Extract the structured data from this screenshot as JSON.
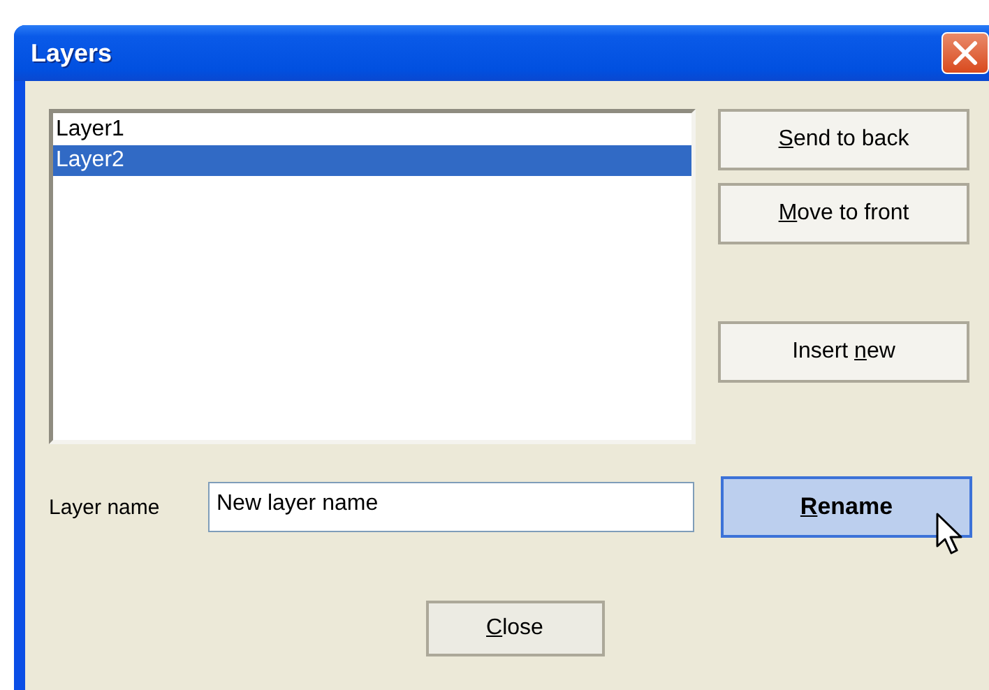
{
  "window": {
    "title": "Layers"
  },
  "layers": {
    "items": [
      {
        "label": "Layer1",
        "selected": false
      },
      {
        "label": "Layer2",
        "selected": true
      }
    ]
  },
  "side_buttons": [
    {
      "key": "S",
      "post": "end to back"
    },
    {
      "key": "M",
      "post": "ove to front"
    },
    {
      "pre": "Insert ",
      "key": "n",
      "post": "ew"
    }
  ],
  "layer_name": {
    "label": "Layer name",
    "value": "New layer name"
  },
  "rename_button": {
    "key": "R",
    "post": "ename",
    "hovered": true
  },
  "close_button": {
    "key": "C",
    "post": "lose"
  }
}
